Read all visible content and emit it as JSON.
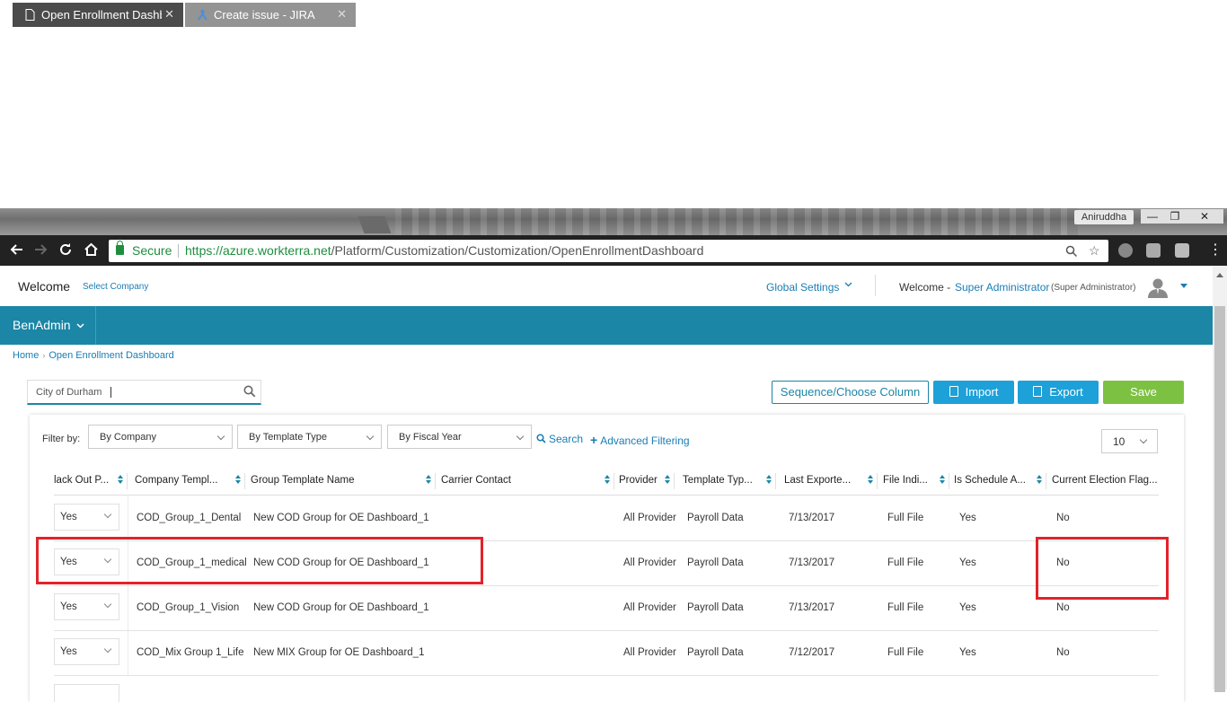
{
  "browser": {
    "tabs": [
      {
        "label": "Open Enrollment Dashbo",
        "close": "✕",
        "active": true
      },
      {
        "label": "Create issue - JIRA",
        "close": "✕",
        "active": false
      }
    ],
    "profile_name": "Aniruddha",
    "window_controls": {
      "minimize": "—",
      "maximize": "❐",
      "close": "✕"
    },
    "secure_label": "Secure",
    "url_host": "https://azure.workterra.net",
    "url_path": "/Platform/Customization/Customization/OpenEnrollmentDashboard"
  },
  "header": {
    "welcome": "Welcome",
    "select_company": "Select Company",
    "global_settings": "Global Settings",
    "welcome_prefix": "Welcome -",
    "user_name": "Super Administrator",
    "user_role": "(Super Administrator)"
  },
  "nav": {
    "menu_label": "BenAdmin"
  },
  "breadcrumb": {
    "home": "Home",
    "current": "Open Enrollment Dashboard"
  },
  "search": {
    "value": "City of Durham"
  },
  "actions": {
    "sequence": "Sequence/Choose Column",
    "import": "Import",
    "export": "Export",
    "save": "Save"
  },
  "filters": {
    "label": "Filter by:",
    "company": "By Company",
    "template_type": "By Template Type",
    "fiscal_year": "By Fiscal Year",
    "search_link": "Search",
    "advanced_link": "Advanced Filtering",
    "page_size": "10"
  },
  "table": {
    "headers": [
      "lack Out P...",
      "Company Templ...",
      "Group Template Name",
      "Carrier Contact",
      "Provider",
      "Template Typ...",
      "Last Exporte...",
      "File Indi...",
      "Is Schedule A...",
      "Current Election Flag..."
    ],
    "rows": [
      {
        "blackout": "Yes",
        "company_template": "COD_Group_1_Dental",
        "group_template": "New COD Group for OE Dashboard_1",
        "carrier_contact": "",
        "provider": "All Provider",
        "template_type": "Payroll Data",
        "last_exported": "7/13/2017",
        "file_indicator": "Full File",
        "is_schedule": "Yes",
        "current_election": "No"
      },
      {
        "blackout": "Yes",
        "company_template": "COD_Group_1_medical",
        "group_template": "New COD Group for OE Dashboard_1",
        "carrier_contact": "",
        "provider": "All Provider",
        "template_type": "Payroll Data",
        "last_exported": "7/13/2017",
        "file_indicator": "Full File",
        "is_schedule": "Yes",
        "current_election": "No"
      },
      {
        "blackout": "Yes",
        "company_template": "COD_Group_1_Vision",
        "group_template": "New COD Group for OE Dashboard_1",
        "carrier_contact": "",
        "provider": "All Provider",
        "template_type": "Payroll Data",
        "last_exported": "7/13/2017",
        "file_indicator": "Full File",
        "is_schedule": "Yes",
        "current_election": "No"
      },
      {
        "blackout": "Yes",
        "company_template": "COD_Mix Group 1_Life",
        "group_template": "New MIX Group for OE Dashboard_1",
        "carrier_contact": "",
        "provider": "All Provider",
        "template_type": "Payroll Data",
        "last_exported": "7/12/2017",
        "file_indicator": "Full File",
        "is_schedule": "Yes",
        "current_election": "No"
      }
    ]
  },
  "colors": {
    "accent": "#1b86a6",
    "button_blue": "#1ea1d8",
    "save_green": "#7dc142",
    "highlight_red": "#e2232a"
  }
}
